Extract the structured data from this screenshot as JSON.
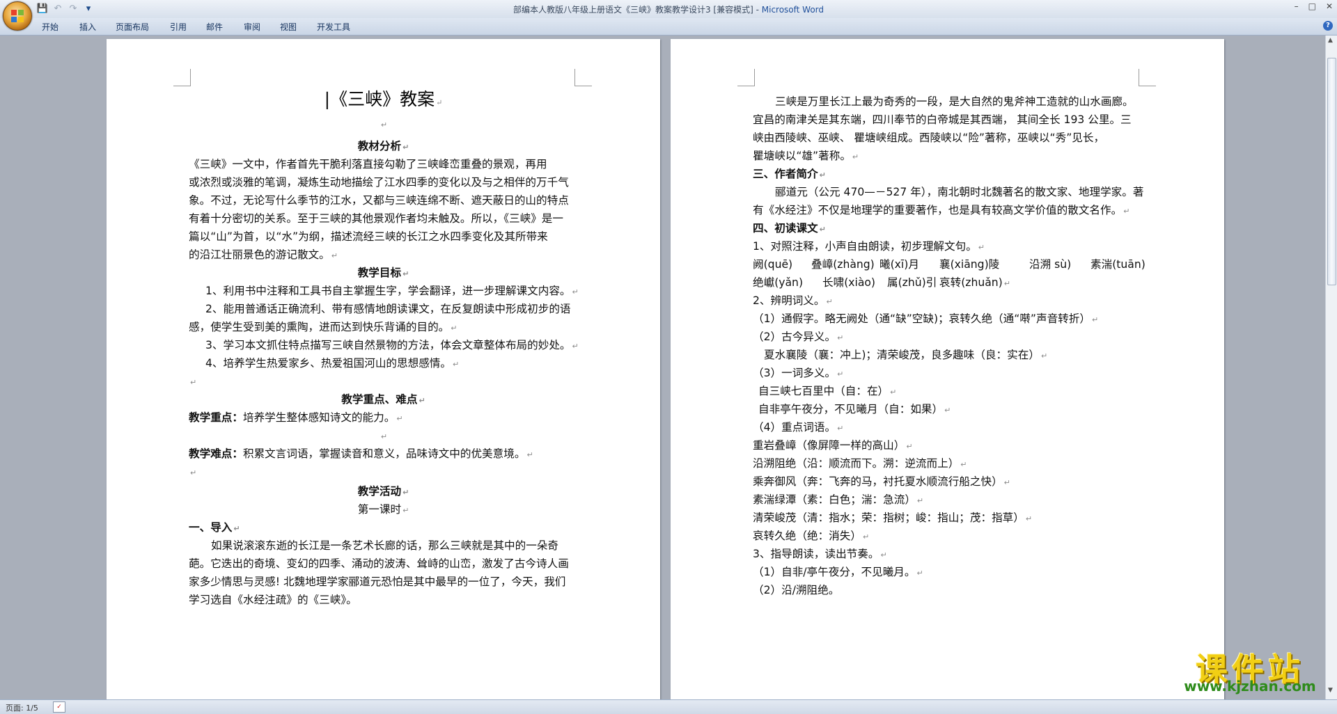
{
  "window": {
    "title_doc": "部编本人教版八年级上册语文《三峡》教案教学设计3 [兼容模式] - ",
    "title_app": "Microsoft Word",
    "min": "–",
    "max": "□",
    "close": "✕"
  },
  "qat": {
    "save": "💾",
    "undo": "↶",
    "redo": "↷",
    "more": "▾"
  },
  "ribbon": {
    "tabs": [
      "开始",
      "插入",
      "页面布局",
      "引用",
      "邮件",
      "审阅",
      "视图",
      "开发工具"
    ],
    "help": "?"
  },
  "page1": {
    "title": "《三峡》教案",
    "lines": [
      "教材分析",
      "《三峡》一文中，作者首先干脆利落直接勾勒了三峡峰峦重叠的景观，再用",
      "或浓烈或淡雅的笔调，凝炼生动地描绘了江水四季的变化以及与之相伴的万千气",
      "象。不过，无论写什么季节的江水，又都与三峡连绵不断、遮天蔽日的山的特点",
      "有着十分密切的关系。至于三峡的其他景观作者均未触及。所以，《三峡》是一",
      "篇以“山”为首，以“水”为纲，描述流经三峡的长江之水四季变化及其所带来",
      "的沿江壮丽景色的游记散文。",
      "教学目标",
      "1、利用书中注释和工具书自主掌握生字，学会翻译，进一步理解课文内容。",
      "2、能用普通话正确流利、带有感情地朗读课文，在反复朗读中形成初步的语",
      "感，使学生受到美的熏陶，进而达到快乐背诵的目的。",
      "3、学习本文抓住特点描写三峡自然景物的方法，体会文章整体布局的妙处。",
      "4、培养学生热爱家乡、热爱祖国河山的思想感情。",
      "教学重点、难点",
      "教学重点：",
      "培养学生整体感知诗文的能力。",
      "教学难点：",
      "积累文言词语，掌握读音和意义，品味诗文中的优美意境。",
      "教学活动",
      "第一课时",
      "一、导入",
      "如果说滚滚东逝的长江是一条艺术长廊的话，那么三峡就是其中的一朵奇",
      "葩。它迭出的奇境、变幻的四季、涌动的波涛、耸峙的山峦，激发了古今诗人画",
      "家多少情思与灵感! 北魏地理学家郦道元恐怕是其中最早的一位了，今天，我们",
      "学习选自《水经注疏》的《三峡》。"
    ]
  },
  "page2": {
    "lines": [
      "三峡是万里长江上最为奇秀的一段，是大自然的鬼斧神工造就的山水画廊。",
      "宜昌的南津关是其东端，四川奉节的白帝城是其西端，  其间全长 193 公里。三",
      "峡由西陵峡、巫峡、 瞿塘峡组成。西陵峡以“险”著称，巫峡以“秀”见长，",
      "瞿塘峡以“雄”著称。",
      "三、作者简介",
      "郦道元（公元 470—－527 年），南北朝时北魏著名的散文家、地理学家。著",
      "有《水经注》不仅是地理学的重要著作，也是具有较高文学价值的散文名作。",
      "四、初读课文",
      "1、对照注释，小声自由朗读，初步理解文句。",
      "阙(quē)",
      "叠嶂(zhàng)",
      "曦(xī)月",
      "襄(xiāng)陵",
      "沿溯  sù)",
      "素湍(tuān)",
      "绝巘(yǎn)",
      "长啸(xiào)",
      "属(zhǔ)引",
      "哀转(zhuǎn)",
      "2、辨明词义。",
      "（1）通假字。略无阙处（通“缺”空缺)；哀转久绝（通“啭”声音转折）",
      "（2）古今异义。",
      "夏水襄陵（襄：冲上)；清荣峻茂，良多趣味（良：实在）",
      "（3）一词多义。",
      "自三峡七百里中（自：在）",
      "自非亭午夜分，不见曦月（自：如果）",
      "（4）重点词语。",
      "重岩叠嶂（像屏障一样的高山）",
      "沿溯阻绝（沿：顺流而下。溯：逆流而上）",
      "乘奔御风（奔：飞奔的马，衬托夏水顺流行船之快）",
      "素湍绿潭（素：白色；湍：急流）",
      "清荣峻茂（清：指水；荣：指树；峻：指山；茂：指草）",
      "哀转久绝（绝：消失）",
      "3、指导朗读，读出节奏。",
      "（1）自非/亭午夜分，不见曦月。",
      "（2）沿/溯阻绝。"
    ]
  },
  "status": {
    "page": "页面: 1/5"
  },
  "watermark": {
    "main": "课件站",
    "url": "www.kjzhan.com"
  },
  "colors": {
    "accent": "#1f4f9a",
    "watermark_yellow": "#f2cf14",
    "watermark_green": "#2e8b1a"
  }
}
